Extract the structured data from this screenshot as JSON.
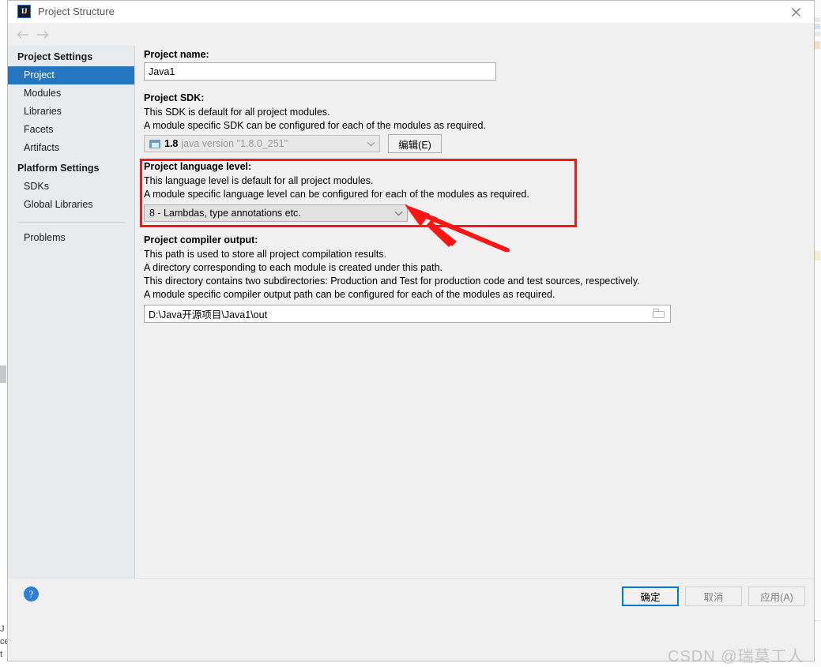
{
  "window": {
    "title": "Project Structure",
    "icon": "intellij-idea-icon",
    "close_label": "×"
  },
  "nav": {
    "back": "←",
    "forward": "→"
  },
  "sidebar": {
    "groups": [
      {
        "label": "Project Settings",
        "items": [
          {
            "label": "Project",
            "selected": true
          },
          {
            "label": "Modules",
            "selected": false
          },
          {
            "label": "Libraries",
            "selected": false
          },
          {
            "label": "Facets",
            "selected": false
          },
          {
            "label": "Artifacts",
            "selected": false
          }
        ]
      },
      {
        "label": "Platform Settings",
        "items": [
          {
            "label": "SDKs",
            "selected": false
          },
          {
            "label": "Global Libraries",
            "selected": false
          }
        ]
      }
    ],
    "problems": "Problems"
  },
  "main": {
    "project_name": {
      "label": "Project name:",
      "value": "Java1",
      "placeholder": ""
    },
    "project_sdk": {
      "label": "Project SDK:",
      "lines": [
        "This SDK is default for all project modules.",
        "A module specific SDK can be configured for each of the modules as required."
      ],
      "version": "1.8",
      "description": "java version \"1.8.0_251\"",
      "edit_button": "编辑(E)"
    },
    "language_level": {
      "label": "Project language level:",
      "lines": [
        "This language level is default for all project modules.",
        "A module specific language level can be configured for each of the modules as required."
      ],
      "value": "8 - Lambdas, type annotations etc."
    },
    "compiler_output": {
      "label": "Project compiler output:",
      "lines": [
        "This path is used to store all project compilation results.",
        "A directory corresponding to each module is created under this path.",
        "This directory contains two subdirectories: Production and Test for production code and test sources, respectively.",
        "A module specific compiler output path can be configured for each of the modules as required."
      ],
      "value": "D:\\Java开源项目\\Java1\\out"
    }
  },
  "footer": {
    "help": "?",
    "ok": "确定",
    "cancel": "取消",
    "apply": "应用(A)"
  },
  "annotation": {
    "highlight_color": "#fb1616",
    "arrow_color": "#fb1616"
  },
  "watermark": {
    "text": "CSDN @瑞莫工人"
  },
  "background": {
    "left_fragments": [
      "J",
      "ce",
      "t"
    ],
    "bottom_text": ""
  },
  "colors": {
    "selection": "#2675bf",
    "sidebar_bg": "#e7ebee",
    "dialog_bg": "#f0f0f0",
    "primary_button_border": "#0078d7",
    "annotation_red": "#fb1616"
  }
}
